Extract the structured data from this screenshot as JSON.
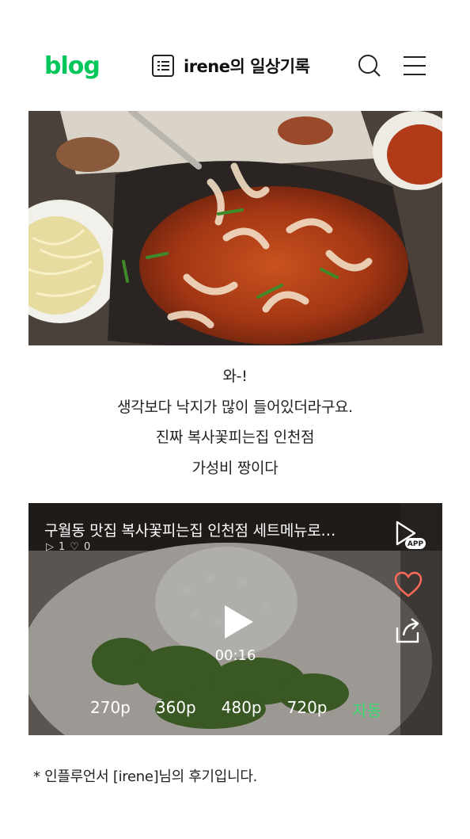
{
  "header": {
    "logo": "blog",
    "blog_title": "irene의 일상기록"
  },
  "caption": {
    "lines": [
      "와-!",
      "생각보다 낙지가 많이 들어있더라구요.",
      "진짜 복사꽃피는집 인천점",
      "가성비 짱이다"
    ]
  },
  "video": {
    "title": "구월동 맛집 복사꽃피는집 인천점 세트메뉴로…",
    "play_count": "1",
    "like_count": "0",
    "app_badge": "APP",
    "duration": "00:16",
    "qualities": [
      "270p",
      "360p",
      "480p",
      "720p",
      "자동"
    ],
    "active_quality": "자동"
  },
  "note": "* 인플루언서 [irene]님의 후기입니다.",
  "colors": {
    "brand": "#03c75a",
    "active_quality": "#3ddc72",
    "heart": "#ff6a5a"
  }
}
